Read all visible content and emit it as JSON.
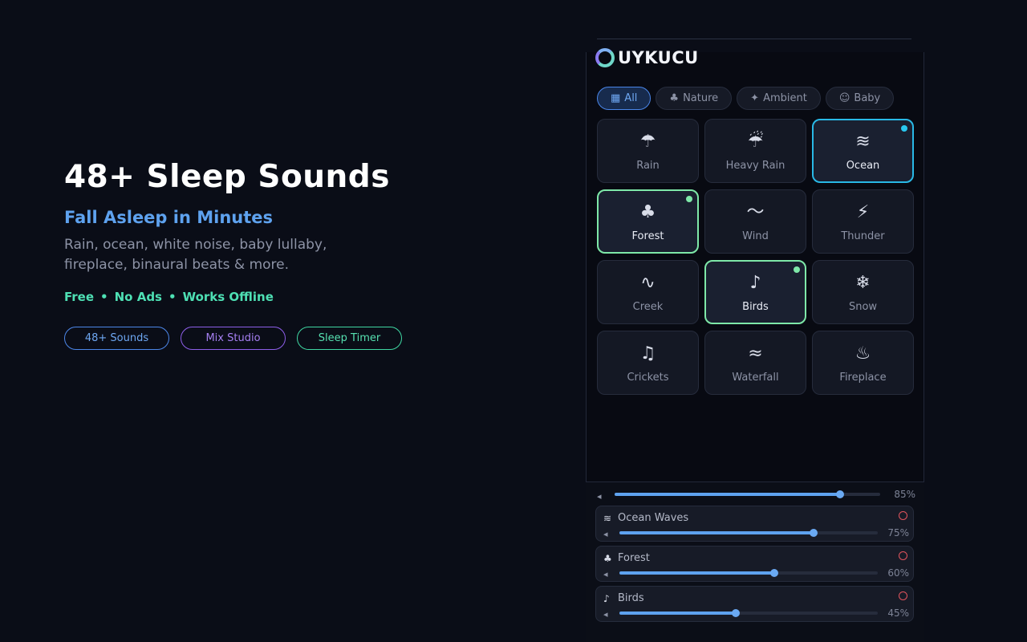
{
  "hero": {
    "title": "48+ Sleep Sounds",
    "subtitle": "Fall Asleep in Minutes",
    "description": "Rain, ocean, white noise, baby lullaby, fireplace, binaural beats & more.",
    "features": [
      "Free",
      "No Ads",
      "Works Offline"
    ],
    "separator": "•",
    "pills": [
      "48+ Sounds",
      "Mix Studio",
      "Sleep Timer"
    ]
  },
  "app": {
    "brand": "UYKUCU",
    "categories": [
      {
        "icon": "grid-icon",
        "glyph": "▦",
        "label": "All",
        "active": true
      },
      {
        "icon": "leaf-icon",
        "glyph": "♣",
        "label": "Nature",
        "active": false
      },
      {
        "icon": "sparkle-icon",
        "glyph": "✦",
        "label": "Ambient",
        "active": false
      },
      {
        "icon": "baby-icon",
        "glyph": "☺",
        "label": "Baby",
        "active": false
      }
    ],
    "sounds": [
      {
        "icon": "rain-icon",
        "glyph": "☂",
        "label": "Rain",
        "state": "off"
      },
      {
        "icon": "heavy-rain-icon",
        "glyph": "☔",
        "label": "Heavy Rain",
        "state": "off"
      },
      {
        "icon": "wave-icon",
        "glyph": "≋",
        "label": "Ocean",
        "state": "blue"
      },
      {
        "icon": "tree-icon",
        "glyph": "♣",
        "label": "Forest",
        "state": "green"
      },
      {
        "icon": "wind-icon",
        "glyph": "〜",
        "label": "Wind",
        "state": "off"
      },
      {
        "icon": "lightning-icon",
        "glyph": "⚡",
        "label": "Thunder",
        "state": "off"
      },
      {
        "icon": "stream-icon",
        "glyph": "∿",
        "label": "Creek",
        "state": "off"
      },
      {
        "icon": "bird-icon",
        "glyph": "♪",
        "label": "Birds",
        "state": "green"
      },
      {
        "icon": "snowflake-icon",
        "glyph": "❄",
        "label": "Snow",
        "state": "off"
      },
      {
        "icon": "cricket-icon",
        "glyph": "♫",
        "label": "Crickets",
        "state": "off"
      },
      {
        "icon": "waterfall-icon",
        "glyph": "≈",
        "label": "Waterfall",
        "state": "off"
      },
      {
        "icon": "fire-icon",
        "glyph": "♨",
        "label": "Fireplace",
        "state": "off"
      }
    ]
  },
  "mixer": {
    "master": {
      "icon": "speaker-icon",
      "glyph": "◂",
      "value": 0.85,
      "label": "85%"
    },
    "tracks": [
      {
        "icon": "wave-icon",
        "glyph": "≋",
        "name": "Ocean Waves",
        "value": 0.75,
        "label": "75%"
      },
      {
        "icon": "tree-icon",
        "glyph": "♣",
        "name": "Forest",
        "value": 0.6,
        "label": "60%"
      },
      {
        "icon": "bird-icon",
        "glyph": "♪",
        "name": "Birds",
        "value": 0.45,
        "label": "45%"
      }
    ]
  },
  "colors": {
    "accent": "#5ea2ef",
    "active_blue": "#29b9e6",
    "active_green": "#7ee8a8",
    "feature_green": "#4ee0b4",
    "remove_red": "#e0545d"
  }
}
